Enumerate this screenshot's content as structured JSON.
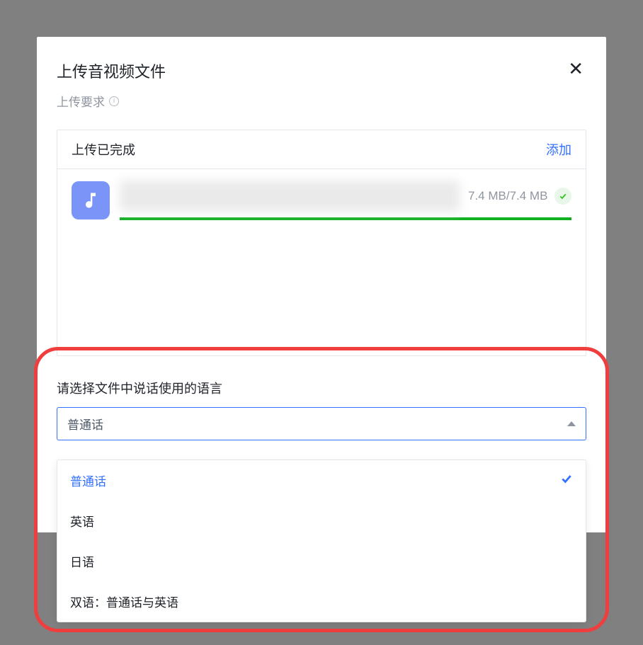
{
  "modal": {
    "title": "上传音视频文件",
    "upload_req_label": "上传要求"
  },
  "upload": {
    "status_label": "上传已完成",
    "add_label": "添加",
    "file": {
      "size_text": "7.4 MB/7.4 MB"
    }
  },
  "language": {
    "prompt": "请选择文件中说话使用的语言",
    "selected": "普通话",
    "options": [
      {
        "label": "普通话",
        "selected": true
      },
      {
        "label": "英语",
        "selected": false
      },
      {
        "label": "日语",
        "selected": false
      },
      {
        "label": "双语：普通话与英语",
        "selected": false
      }
    ]
  }
}
